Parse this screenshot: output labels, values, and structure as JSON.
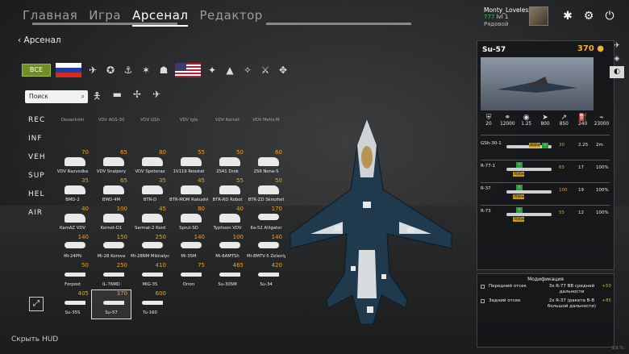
{
  "nav": {
    "tabs": [
      "Главная",
      "Игра",
      "Арсенал",
      "Редактор"
    ],
    "active": 2
  },
  "user": {
    "nick": "Monty_Loveless",
    "currency": "777",
    "level": "lvl 1",
    "rank": "Рядовой"
  },
  "breadcrumb": "Арсенал",
  "filters": {
    "all_label": "ВСЕ"
  },
  "search": {
    "placeholder": "Поиск"
  },
  "categories": [
    "REC",
    "INF",
    "VEH",
    "SUP",
    "HEL",
    "AIR"
  ],
  "units": [
    [
      {
        "name": "Desantniki",
        "cost": "",
        "kind": "inf",
        "cropped": true
      },
      {
        "name": "VDV AGS-30",
        "cost": "",
        "kind": "inf",
        "cropped": true
      },
      {
        "name": "VDV GSh",
        "cost": "",
        "kind": "inf",
        "cropped": true
      },
      {
        "name": "VDV Igla",
        "cost": "",
        "kind": "inf",
        "cropped": true
      },
      {
        "name": "VDV Kornet",
        "cost": "",
        "kind": "inf",
        "cropped": true
      },
      {
        "name": "VDV Metis-M",
        "cost": "",
        "kind": "inf",
        "cropped": true
      }
    ],
    [
      {
        "name": "VDV Razvedka",
        "cost": "70",
        "kind": "inf"
      },
      {
        "name": "VDV Snaipery",
        "cost": "65",
        "kind": "inf"
      },
      {
        "name": "VDV Spetsnaz",
        "cost": "80",
        "kind": "inf"
      },
      {
        "name": "1V119 Reostat",
        "cost": "55",
        "kind": "veh"
      },
      {
        "name": "2S41 Drok",
        "cost": "50",
        "kind": "veh"
      },
      {
        "name": "2S9 Nona-S",
        "cost": "60",
        "kind": "veh"
      }
    ],
    [
      {
        "name": "BMD-2",
        "cost": "35",
        "kind": "veh"
      },
      {
        "name": "BMD-4M",
        "cost": "65",
        "kind": "veh"
      },
      {
        "name": "BTR-D",
        "cost": "35",
        "kind": "veh"
      },
      {
        "name": "BTR-MDM Rakushka",
        "cost": "45",
        "kind": "veh"
      },
      {
        "name": "BTR-RD Robot",
        "cost": "55",
        "kind": "veh"
      },
      {
        "name": "BTR-ZD Skrezhet",
        "cost": "50",
        "kind": "veh"
      }
    ],
    [
      {
        "name": "KamAZ VDV",
        "cost": "40",
        "kind": "veh"
      },
      {
        "name": "Kornet-D1",
        "cost": "100",
        "kind": "veh"
      },
      {
        "name": "Sarmat-2 Kord",
        "cost": "45",
        "kind": "veh"
      },
      {
        "name": "Sprut-SD",
        "cost": "80",
        "kind": "veh"
      },
      {
        "name": "Typhoon VDV",
        "cost": "40",
        "kind": "veh"
      },
      {
        "name": "Ka-52 Alligator",
        "cost": "170",
        "kind": "heli"
      }
    ],
    [
      {
        "name": "Mi-24PN",
        "cost": "140",
        "kind": "heli"
      },
      {
        "name": "Mi-28 Korova",
        "cost": "150",
        "kind": "heli"
      },
      {
        "name": "Mi-28NM Mikhalych",
        "cost": "250",
        "kind": "heli"
      },
      {
        "name": "Mi-35M",
        "cost": "140",
        "kind": "heli"
      },
      {
        "name": "Mi-8AMTSh",
        "cost": "100",
        "kind": "heli"
      },
      {
        "name": "Mi-8MTV-5 Zelenly",
        "cost": "140",
        "kind": "heli"
      }
    ],
    [
      {
        "name": "Forpost",
        "cost": "50",
        "kind": "air"
      },
      {
        "name": "IL-76MD",
        "cost": "250",
        "kind": "air"
      },
      {
        "name": "MiG-35",
        "cost": "410",
        "kind": "air"
      },
      {
        "name": "Orion",
        "cost": "75",
        "kind": "air"
      },
      {
        "name": "Su-30SM",
        "cost": "465",
        "kind": "air"
      },
      {
        "name": "Su-34",
        "cost": "420",
        "kind": "air"
      }
    ],
    [
      {
        "name": "Su-35S",
        "cost": "405",
        "kind": "air"
      },
      {
        "name": "Su-57",
        "cost": "370",
        "kind": "air",
        "selected": true
      },
      {
        "name": "Tu-160",
        "cost": "600",
        "kind": "air"
      }
    ]
  ],
  "hide_hud": "Скрыть HUD",
  "panel": {
    "title": "Su-57",
    "cost": "370",
    "stats": [
      "20",
      "12000",
      "1.25",
      "800",
      "850",
      "240",
      "23000"
    ],
    "weapons": [
      {
        "name": "GSh-30-1",
        "tag": "3000м",
        "v1": "30",
        "v2": "2.25",
        "v3": "2m"
      },
      {
        "name": "R-77-1",
        "tag": "7000м",
        "v1": "65",
        "v2": "17",
        "v3": "100%"
      },
      {
        "name": "R-37",
        "tag": "7000м",
        "v1": "100",
        "v2": "19",
        "v3": "100%"
      },
      {
        "name": "R-73",
        "tag": "7000м",
        "v1": "55",
        "v2": "12",
        "v3": "100%"
      }
    ]
  },
  "mods": {
    "header": "Модификация",
    "items": [
      {
        "label": "Передний отсек",
        "desc": "3x R-77 ВВ средней дальности",
        "plus": "+50"
      },
      {
        "label": "Задний отсек",
        "desc": "2x R-37 (ракета В-В большой дальности)",
        "plus": "+85"
      }
    ]
  },
  "version": "1.0.7c"
}
